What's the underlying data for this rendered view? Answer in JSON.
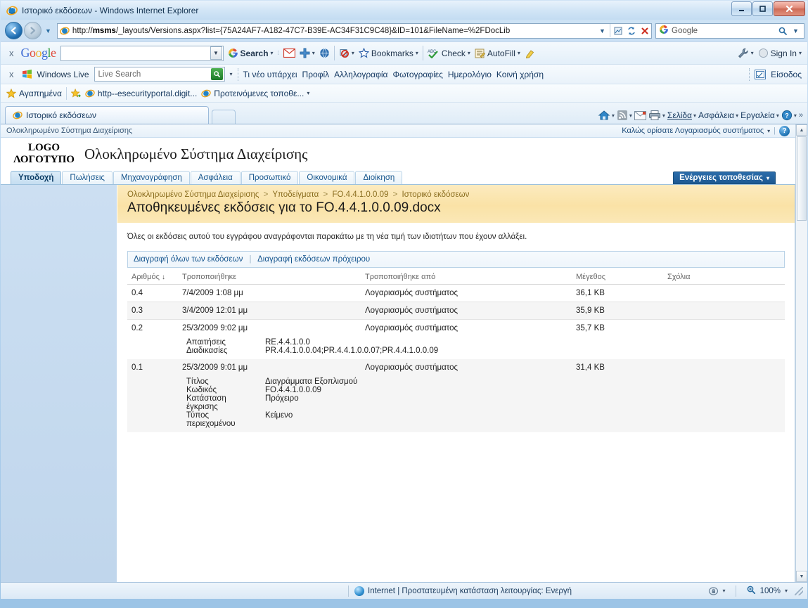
{
  "window": {
    "title": "Ιστορικό εκδόσεων - Windows Internet Explorer",
    "minimize": "−",
    "maximize": "❐",
    "close": "✕"
  },
  "address": {
    "url_prefix": "http://",
    "url_host": "msms",
    "url_rest": "/_layouts/Versions.aspx?list={75A24AF7-A182-47C7-B39E-AC34F31C9C48}&ID=101&FileName=%2FDocLib",
    "full_url": "http://msms/_layouts/Versions.aspx?list={75A24AF7-A182-47C7-B39E-AC34F31C9C48}&ID=101&FileName=%2FDocLib",
    "dropdown_caret": "▾",
    "compat_icon": "compatibility-view-icon",
    "refresh_icon": "↻",
    "stop_icon": "✕",
    "search_value": "Google",
    "search_icon": "🔍"
  },
  "google_toolbar": {
    "close_label": "x",
    "logo": [
      "G",
      "o",
      "o",
      "g",
      "l",
      "e"
    ],
    "search_value": "",
    "search_caret": "▾",
    "items": [
      {
        "label": "Search",
        "caret": "▾",
        "icon": "google-search-icon"
      },
      {
        "label": "",
        "caret": "",
        "icon": "gmail-icon"
      },
      {
        "label": "",
        "caret": "▾",
        "icon": "plus-icon"
      },
      {
        "label": "",
        "caret": "",
        "icon": "globe-icon"
      },
      {
        "label": "",
        "caret": "▾",
        "icon": "popup-blocker-icon"
      },
      {
        "label": "Bookmarks",
        "caret": "▾",
        "icon": "star-icon"
      },
      {
        "label": "Check",
        "caret": "▾",
        "icon": "spellcheck-icon"
      },
      {
        "label": "AutoFill",
        "caret": "▾",
        "icon": "autofill-icon"
      },
      {
        "label": "",
        "caret": "",
        "icon": "highlighter-icon"
      }
    ],
    "settings_label": "",
    "settings_caret": "▾",
    "signin_label": "Sign In",
    "signin_caret": "▾"
  },
  "live_toolbar": {
    "close_label": "x",
    "brand": "Windows Live",
    "search_placeholder": "Live Search",
    "search_value": "",
    "go_icon": "🔍",
    "caret": "▾",
    "links": [
      "Τι νέο υπάρχει",
      "Προφίλ",
      "Αλληλογραφία",
      "Φωτογραφίες",
      "Ημερολόγιο",
      "Κοινή χρήση"
    ],
    "signin_label": "Είσοδος"
  },
  "favorites_bar": {
    "favorites_label": "Αγαπημένα",
    "items": [
      {
        "label": "http--esecurityportal.digit...",
        "icon": "ie-page-icon"
      },
      {
        "label": "Προτεινόμενες τοποθε...",
        "icon": "ie-page-icon"
      }
    ],
    "overflow_caret": "▾"
  },
  "browser_tabs": {
    "tabs": [
      {
        "label": "Ιστορικό εκδόσεων",
        "icon": "ie-tab-icon"
      }
    ],
    "new_tab_label": ""
  },
  "command_bar": {
    "items": [
      {
        "label": "",
        "icon": "home-icon",
        "caret": "▾"
      },
      {
        "label": "",
        "icon": "feeds-icon",
        "caret": "▾"
      },
      {
        "label": "",
        "icon": "mail-icon",
        "caret": ""
      },
      {
        "label": "",
        "icon": "print-icon",
        "caret": "▾"
      },
      {
        "label": "Σελίδα",
        "icon": "",
        "caret": "▾"
      },
      {
        "label": "Ασφάλεια",
        "icon": "",
        "caret": "▾"
      },
      {
        "label": "Εργαλεία",
        "icon": "",
        "caret": "▾"
      },
      {
        "label": "",
        "icon": "help-icon",
        "caret": "▾"
      }
    ],
    "overflow": "»"
  },
  "sharepoint": {
    "global_nav_title": "Ολοκληρωμένο Σύστημα Διαχείρισης",
    "welcome_text": "Καλώς ορίσατε Λογαριασμός συστήματος",
    "welcome_caret": "▾",
    "welcome_pipe": "|",
    "help_icon_label": "?",
    "logo_line1": "LOGO",
    "logo_line2": "ΛΟΓΟΤΥΠΟ",
    "site_title": "Ολοκληρωμένο Σύστημα Διαχείρισης",
    "nav_tabs": [
      {
        "label": "Υποδοχή",
        "active": true
      },
      {
        "label": "Πωλήσεις",
        "active": false
      },
      {
        "label": "Μηχανογράφηση",
        "active": false
      },
      {
        "label": "Ασφάλεια",
        "active": false
      },
      {
        "label": "Προσωπικό",
        "active": false
      },
      {
        "label": "Οικονομικά",
        "active": false
      },
      {
        "label": "Διοίκηση",
        "active": false
      }
    ],
    "site_actions_label": "Ενέργειες τοποθεσίας",
    "site_actions_caret": "▾",
    "breadcrumb": [
      "Ολοκληρωμένο Σύστημα Διαχείρισης",
      "Υποδείγματα",
      "FO.4.4.1.0.0.09",
      "Ιστορικό εκδόσεων"
    ],
    "breadcrumb_separator": ">",
    "page_title": "Αποθηκευμένες εκδόσεις για το FO.4.4.1.0.0.09.docx",
    "description": "Όλες οι εκδόσεις αυτού του εγγράφου αναγράφονται παρακάτω με τη νέα τιμή των ιδιοτήτων που έχουν αλλάξει.",
    "actions": {
      "delete_all": "Διαγραφή όλων των εκδόσεων",
      "separator": "|",
      "delete_drafts": "Διαγραφή εκδόσεων πρόχειρου"
    },
    "table": {
      "columns": [
        "Αριθμός",
        "Τροποποιήθηκε",
        "Τροποποιήθηκε από",
        "Μέγεθος",
        "Σχόλια"
      ],
      "sort_indicator": "↓",
      "rows": [
        {
          "number": "0.4",
          "modified": "7/4/2009 1:08 μμ",
          "modified_by": "Λογαριασμός συστήματος",
          "size": "36,1 KB",
          "comments": "",
          "details": []
        },
        {
          "number": "0.3",
          "modified": "3/4/2009 12:01 μμ",
          "modified_by": "Λογαριασμός συστήματος",
          "size": "35,9 KB",
          "comments": "",
          "details": []
        },
        {
          "number": "0.2",
          "modified": "25/3/2009 9:02 μμ",
          "modified_by": "Λογαριασμός συστήματος",
          "size": "35,7 KB",
          "comments": "",
          "details": [
            {
              "label": "Απαιτήσεις",
              "value": "RE.4.4.1.0.0"
            },
            {
              "label": "Διαδικασίες",
              "value": "PR.4.4.1.0.0.04;PR.4.4.1.0.0.07;PR.4.4.1.0.0.09"
            }
          ]
        },
        {
          "number": "0.1",
          "modified": "25/3/2009 9:01 μμ",
          "modified_by": "Λογαριασμός συστήματος",
          "size": "31,4 KB",
          "comments": "",
          "details": [
            {
              "label": "Τίτλος",
              "value": "Διαγράμματα Εξοπλισμού"
            },
            {
              "label": "Κωδικός",
              "value": "FO.4.4.1.0.0.09"
            },
            {
              "label": "Κατάσταση έγκρισης",
              "value": "Πρόχειρο"
            },
            {
              "label": "Τύπος περιεχομένου",
              "value": "Κείμενο"
            }
          ]
        }
      ]
    }
  },
  "status_bar": {
    "zone_text": "Internet | Προστατευμένη κατάσταση λειτουργίας: Ενεργή",
    "zone_icon": "internet-globe-icon",
    "privacy_caret": "▾",
    "zoom_level": "100%",
    "zoom_caret": "▾"
  }
}
